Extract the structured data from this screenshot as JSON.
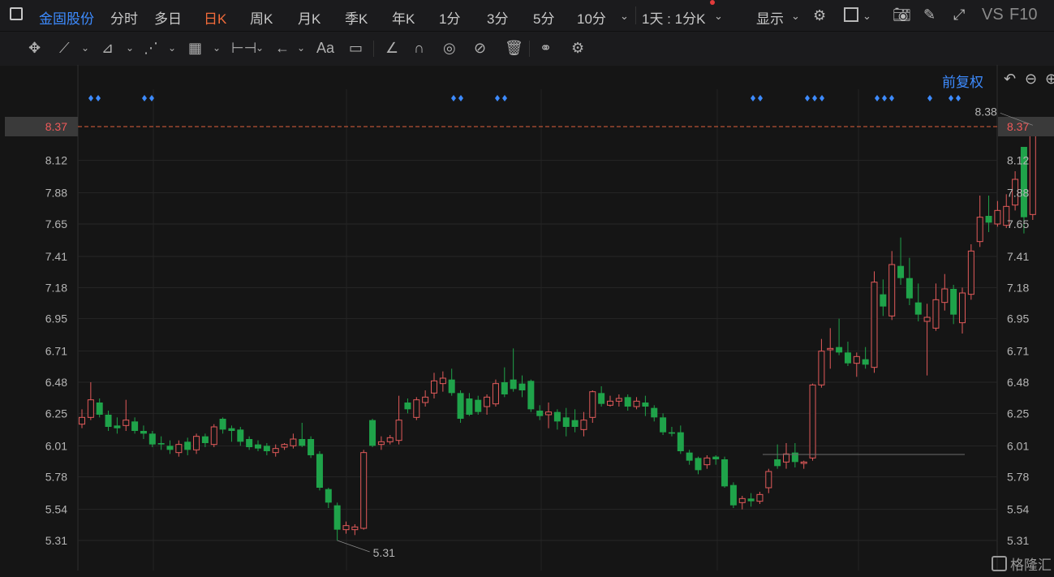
{
  "header": {
    "stock_name": "金固股份",
    "tabs": [
      "分时",
      "多日",
      "日K",
      "周K",
      "月K",
      "季K",
      "年K",
      "1分",
      "3分",
      "5分",
      "10分"
    ],
    "active_tab": "日K",
    "period_select": "1天 : 1分K",
    "display_label": "显示",
    "vs_label": "VS",
    "f10_label": "F10",
    "accent_color": "#f26b3a",
    "link_color": "#3d8bff"
  },
  "toolbar": {
    "icons": [
      "move-icon",
      "line-icon",
      "polyline-icon",
      "wave-icon",
      "grid-icon",
      "measure-icon",
      "arrow-icon",
      "text-icon",
      "comment-icon",
      "eraser-icon",
      "magnet-icon",
      "eye-icon",
      "hide-icon",
      "trash-icon",
      "compare-icon",
      "settings-icon"
    ],
    "text_tool": "Aa"
  },
  "adjust_label": "前复权",
  "watermark": "格隆汇",
  "chart_data": {
    "type": "candlestick",
    "up_color": "#e25a5a",
    "down_color": "#1fa34a",
    "current_price": "8.37",
    "y_ticks": [
      "8.37",
      "8.12",
      "7.88",
      "7.65",
      "7.41",
      "7.18",
      "6.95",
      "6.71",
      "6.48",
      "6.25",
      "6.01",
      "5.78",
      "5.54",
      "5.31"
    ],
    "ylim": [
      5.31,
      8.37
    ],
    "high_label": "8.38",
    "low_label": "5.31",
    "candles": [
      [
        6.17,
        6.22,
        6.14,
        6.28
      ],
      [
        6.22,
        6.35,
        6.2,
        6.48
      ],
      [
        6.33,
        6.24,
        6.22,
        6.36
      ],
      [
        6.24,
        6.15,
        6.12,
        6.27
      ],
      [
        6.16,
        6.14,
        6.1,
        6.22
      ],
      [
        6.16,
        6.2,
        6.12,
        6.35
      ],
      [
        6.19,
        6.12,
        6.1,
        6.22
      ],
      [
        6.12,
        6.1,
        6.06,
        6.16
      ],
      [
        6.1,
        6.02,
        6.0,
        6.12
      ],
      [
        6.03,
        6.02,
        5.98,
        6.08
      ],
      [
        6.01,
        5.98,
        5.95,
        6.05
      ],
      [
        5.96,
        6.02,
        5.93,
        6.05
      ],
      [
        6.04,
        5.98,
        5.94,
        6.07
      ],
      [
        5.98,
        6.08,
        5.95,
        6.1
      ],
      [
        6.08,
        6.03,
        6.0,
        6.1
      ],
      [
        6.02,
        6.15,
        6.0,
        6.17
      ],
      [
        6.21,
        6.13,
        6.1,
        6.22
      ],
      [
        6.14,
        6.12,
        6.04,
        6.16
      ],
      [
        6.13,
        6.04,
        6.01,
        6.15
      ],
      [
        6.06,
        6.0,
        5.98,
        6.08
      ],
      [
        6.02,
        5.99,
        5.97,
        6.05
      ],
      [
        6.01,
        5.97,
        5.94,
        6.03
      ],
      [
        5.96,
        5.99,
        5.93,
        6.02
      ],
      [
        6.0,
        6.02,
        5.98,
        6.03
      ],
      [
        6.01,
        6.06,
        5.99,
        6.1
      ],
      [
        6.06,
        6.01,
        6.0,
        6.18
      ],
      [
        6.06,
        5.94,
        5.92,
        6.08
      ],
      [
        5.95,
        5.7,
        5.68,
        5.97
      ],
      [
        5.69,
        5.59,
        5.55,
        5.7
      ],
      [
        5.57,
        5.39,
        5.31,
        5.59
      ],
      [
        5.39,
        5.42,
        5.36,
        5.45
      ],
      [
        5.39,
        5.41,
        5.35,
        5.43
      ],
      [
        5.4,
        5.96,
        5.39,
        5.98
      ],
      [
        6.2,
        6.01,
        6.0,
        6.21
      ],
      [
        6.02,
        6.04,
        5.98,
        6.08
      ],
      [
        6.04,
        6.07,
        6.02,
        6.09
      ],
      [
        6.05,
        6.2,
        6.02,
        6.38
      ],
      [
        6.33,
        6.28,
        6.25,
        6.36
      ],
      [
        6.22,
        6.35,
        6.2,
        6.37
      ],
      [
        6.33,
        6.37,
        6.3,
        6.42
      ],
      [
        6.4,
        6.49,
        6.36,
        6.55
      ],
      [
        6.47,
        6.51,
        6.41,
        6.56
      ],
      [
        6.5,
        6.4,
        6.38,
        6.58
      ],
      [
        6.4,
        6.21,
        6.18,
        6.42
      ],
      [
        6.36,
        6.24,
        6.23,
        6.4
      ],
      [
        6.35,
        6.26,
        6.24,
        6.38
      ],
      [
        6.3,
        6.37,
        6.24,
        6.39
      ],
      [
        6.32,
        6.47,
        6.3,
        6.5
      ],
      [
        6.48,
        6.39,
        6.37,
        6.59
      ],
      [
        6.5,
        6.43,
        6.41,
        6.73
      ],
      [
        6.47,
        6.42,
        6.37,
        6.53
      ],
      [
        6.49,
        6.28,
        6.26,
        6.5
      ],
      [
        6.27,
        6.23,
        6.2,
        6.31
      ],
      [
        6.24,
        6.26,
        6.14,
        6.33
      ],
      [
        6.26,
        6.19,
        6.13,
        6.28
      ],
      [
        6.22,
        6.15,
        6.08,
        6.29
      ],
      [
        6.2,
        6.15,
        6.11,
        6.28
      ],
      [
        6.13,
        6.2,
        6.08,
        6.26
      ],
      [
        6.22,
        6.41,
        6.18,
        6.42
      ],
      [
        6.4,
        6.32,
        6.3,
        6.45
      ],
      [
        6.31,
        6.34,
        6.3,
        6.38
      ],
      [
        6.34,
        6.36,
        6.3,
        6.39
      ],
      [
        6.37,
        6.3,
        6.27,
        6.39
      ],
      [
        6.3,
        6.34,
        6.28,
        6.37
      ],
      [
        6.33,
        6.3,
        6.23,
        6.38
      ],
      [
        6.29,
        6.22,
        6.19,
        6.31
      ],
      [
        6.22,
        6.11,
        6.09,
        6.25
      ],
      [
        6.11,
        6.1,
        6.08,
        6.15
      ],
      [
        6.11,
        5.97,
        5.95,
        6.16
      ],
      [
        5.96,
        5.9,
        5.87,
        5.98
      ],
      [
        5.92,
        5.83,
        5.8,
        5.93
      ],
      [
        5.87,
        5.92,
        5.84,
        5.94
      ],
      [
        5.93,
        5.91,
        5.87,
        5.94
      ],
      [
        5.91,
        5.71,
        5.7,
        5.93
      ],
      [
        5.72,
        5.57,
        5.55,
        5.74
      ],
      [
        5.59,
        5.62,
        5.54,
        5.64
      ],
      [
        5.62,
        5.6,
        5.56,
        5.66
      ],
      [
        5.6,
        5.65,
        5.58,
        5.67
      ],
      [
        5.7,
        5.82,
        5.66,
        5.84
      ],
      [
        5.91,
        5.86,
        5.84,
        6.02
      ],
      [
        5.89,
        5.95,
        5.84,
        6.03
      ],
      [
        5.96,
        5.89,
        5.85,
        6.03
      ],
      [
        5.88,
        5.89,
        5.84,
        5.9
      ],
      [
        5.92,
        6.46,
        5.9,
        6.47
      ],
      [
        6.46,
        6.71,
        6.44,
        6.8
      ],
      [
        6.72,
        6.73,
        6.58,
        6.88
      ],
      [
        6.74,
        6.7,
        6.68,
        6.95
      ],
      [
        6.7,
        6.62,
        6.6,
        6.78
      ],
      [
        6.62,
        6.67,
        6.52,
        6.7
      ],
      [
        6.65,
        6.61,
        6.58,
        6.74
      ],
      [
        6.59,
        7.22,
        6.55,
        7.3
      ],
      [
        7.13,
        7.04,
        6.97,
        7.24
      ],
      [
        6.97,
        7.35,
        6.94,
        7.45
      ],
      [
        7.34,
        7.25,
        7.2,
        7.55
      ],
      [
        7.25,
        7.1,
        7.05,
        7.4
      ],
      [
        7.07,
        6.98,
        6.93,
        7.21
      ],
      [
        6.93,
        6.96,
        6.53,
        7.06
      ],
      [
        6.88,
        7.09,
        6.86,
        7.21
      ],
      [
        7.07,
        7.17,
        7.01,
        7.28
      ],
      [
        7.17,
        6.98,
        6.91,
        7.2
      ],
      [
        6.92,
        7.14,
        6.84,
        7.18
      ],
      [
        7.13,
        7.45,
        7.09,
        7.5
      ],
      [
        7.52,
        7.7,
        7.48,
        7.86
      ],
      [
        7.71,
        7.66,
        7.59,
        7.86
      ],
      [
        7.65,
        7.75,
        7.63,
        7.82
      ],
      [
        7.64,
        7.78,
        7.62,
        7.87
      ],
      [
        7.79,
        7.98,
        7.75,
        8.04
      ],
      [
        8.22,
        7.7,
        7.58,
        8.22
      ],
      [
        7.72,
        8.38,
        7.68,
        8.38
      ]
    ]
  }
}
